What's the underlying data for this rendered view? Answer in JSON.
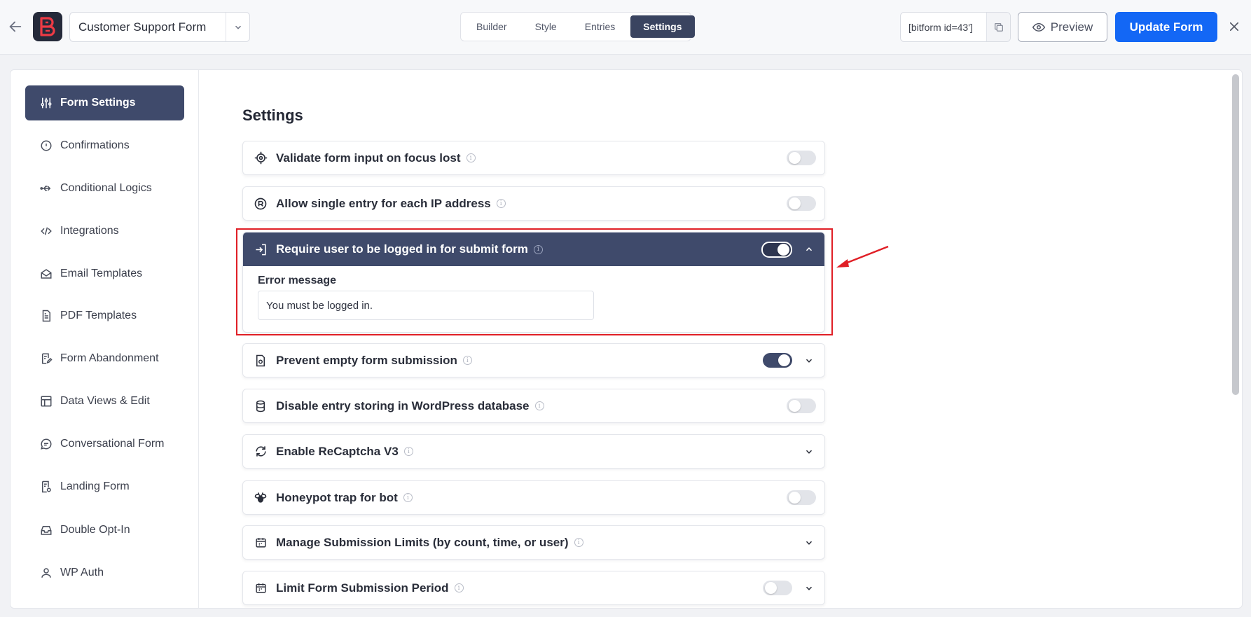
{
  "topbar": {
    "form_name": "Customer Support Form",
    "tabs": [
      {
        "label": "Builder"
      },
      {
        "label": "Style"
      },
      {
        "label": "Entries"
      },
      {
        "label": "Settings"
      }
    ],
    "active_tab": "Settings",
    "shortcode": "[bitform id=43']",
    "preview_label": "Preview",
    "update_label": "Update Form"
  },
  "sidebar": {
    "items": [
      {
        "label": "Form Settings",
        "icon": "sliders-icon"
      },
      {
        "label": "Confirmations",
        "icon": "info-circle-icon"
      },
      {
        "label": "Conditional Logics",
        "icon": "usb-icon"
      },
      {
        "label": "Integrations",
        "icon": "code-icon"
      },
      {
        "label": "Email Templates",
        "icon": "mail-open-icon"
      },
      {
        "label": "PDF Templates",
        "icon": "document-icon"
      },
      {
        "label": "Form Abandonment",
        "icon": "form-edit-icon"
      },
      {
        "label": "Data Views & Edit",
        "icon": "table-icon"
      },
      {
        "label": "Conversational Form",
        "icon": "chat-icon"
      },
      {
        "label": "Landing Form",
        "icon": "landing-icon"
      },
      {
        "label": "Double Opt-In",
        "icon": "inbox-icon"
      },
      {
        "label": "WP Auth",
        "icon": "user-icon"
      }
    ]
  },
  "settings": {
    "title": "Settings",
    "rows": [
      {
        "label": "Validate form input on focus lost",
        "toggle": false,
        "expandable": false
      },
      {
        "label": "Allow single entry for each IP address",
        "toggle": false,
        "expandable": false
      },
      {
        "label": "Require user to be logged in for submit form",
        "toggle": true,
        "expandable": true,
        "expanded": true
      },
      {
        "label": "Prevent empty form submission",
        "toggle": true,
        "expandable": true
      },
      {
        "label": "Disable entry storing in WordPress database",
        "toggle": false,
        "expandable": false
      },
      {
        "label": "Enable ReCaptcha V3",
        "expandable": true
      },
      {
        "label": "Honeypot trap for bot",
        "toggle": false,
        "expandable": false
      },
      {
        "label": "Manage Submission Limits (by count, time, or user)",
        "expandable": true
      },
      {
        "label": "Limit Form Submission Period",
        "toggle": false,
        "expandable": true
      }
    ],
    "error_message_label": "Error message",
    "error_message_value": "You must be logged in."
  },
  "colors": {
    "accent": "#3f4a6b",
    "primary_button": "#1367f5",
    "highlight": "#e01f26"
  }
}
